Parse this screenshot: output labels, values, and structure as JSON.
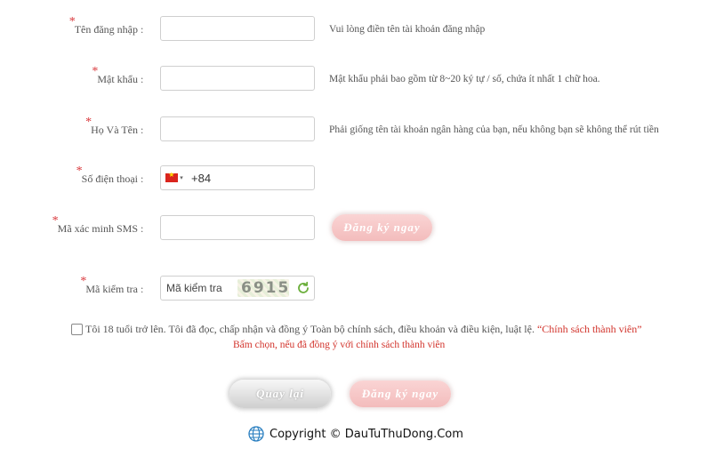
{
  "form": {
    "username": {
      "label": "Tên đăng nhập",
      "required_mark": "*",
      "colon": ":",
      "value": "",
      "hint": "Vui lòng điền tên tài khoản đăng nhập"
    },
    "password": {
      "label": "Mật khẩu",
      "required_mark": "*",
      "colon": ":",
      "value": "",
      "hint": "Mật khẩu phải bao gồm từ 8~20 ký tự / số, chứa ít nhất 1 chữ hoa."
    },
    "fullname": {
      "label": "Họ Và Tên",
      "required_mark": "*",
      "colon": ":",
      "value": "",
      "hint": "Phải giống tên tài khoản ngân hàng của bạn, nếu không bạn sẽ không thể rút tiền"
    },
    "phone": {
      "label": "Số điện thoại",
      "required_mark": "*",
      "colon": ":",
      "value": "+84",
      "flag_icon": "vietnam-flag-icon",
      "caret": "▾"
    },
    "sms": {
      "label": "Mã xác minh SMS",
      "required_mark": "*",
      "colon": ":",
      "value": "",
      "button": "Đăng ký ngay"
    },
    "captcha": {
      "label": "Mã kiểm tra",
      "required_mark": "*",
      "colon": ":",
      "placeholder": "Mã kiểm tra",
      "image_text": "6915",
      "refresh_icon": "refresh-icon"
    },
    "agree": {
      "checked": false,
      "text": "Tôi 18 tuổi trở lên. Tôi đã đọc, chấp nhận và đồng ý Toàn bộ chính sách, điều khoản và điều kiện, luật lệ.",
      "policy_link": "“Chính sách thành viên”",
      "note": "Bấm chọn, nếu đã đồng ý với chính sách thành viên"
    }
  },
  "actions": {
    "back": "Quay lại",
    "register": "Đăng ký ngay"
  },
  "footer": {
    "globe_icon": "globe-icon",
    "copyright": "Copyright © DauTuThuDong.Com"
  },
  "colors": {
    "required": "#d9373b",
    "link": "#d2342c",
    "pink_button": "#f3bcbc"
  }
}
